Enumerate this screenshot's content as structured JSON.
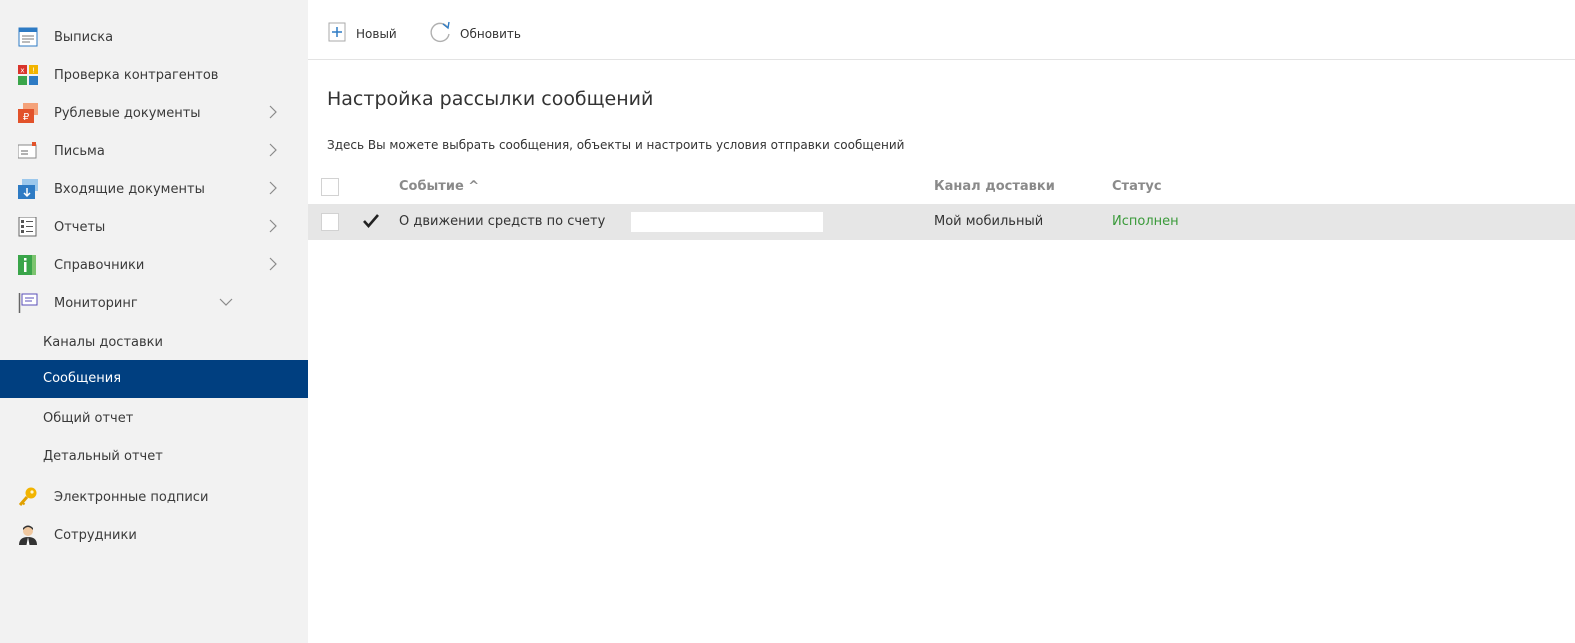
{
  "sidebar": {
    "items": [
      {
        "label": "Выписка",
        "icon": "statement-icon",
        "has_chevron": false
      },
      {
        "label": "Проверка контрагентов",
        "icon": "contractor-check-icon",
        "has_chevron": false
      },
      {
        "label": "Рублевые документы",
        "icon": "ruble-documents-icon",
        "has_chevron": true
      },
      {
        "label": "Письма",
        "icon": "letters-icon",
        "has_chevron": true
      },
      {
        "label": "Входящие документы",
        "icon": "incoming-documents-icon",
        "has_chevron": true
      },
      {
        "label": "Отчеты",
        "icon": "reports-icon",
        "has_chevron": true
      },
      {
        "label": "Справочники",
        "icon": "directories-icon",
        "has_chevron": true
      },
      {
        "label": "Мониторинг",
        "icon": "monitoring-icon",
        "has_chevron": true,
        "expanded": true
      }
    ],
    "subitems": [
      {
        "label": "Каналы доставки",
        "active": false
      },
      {
        "label": "Сообщения",
        "active": true
      },
      {
        "label": "Общий отчет",
        "active": false
      },
      {
        "label": "Детальный отчет",
        "active": false
      }
    ],
    "bottom_items": [
      {
        "label": "Электронные подписи",
        "icon": "key-icon"
      },
      {
        "label": "Сотрудники",
        "icon": "employee-icon"
      }
    ],
    "active_color": "#003f80"
  },
  "toolbar": {
    "new_label": "Новый",
    "refresh_label": "Обновить"
  },
  "main": {
    "title": "Настройка рассылки сообщений",
    "description": "Здесь Вы можете выбрать сообщения, объекты и настроить условия отправки сообщений"
  },
  "table": {
    "columns": {
      "event": "Событие ^",
      "channel": "Канал доставки",
      "status": "Статус"
    },
    "rows": [
      {
        "event": "О движении средств по счету",
        "channel": "Мой мобильный",
        "status": "Исполнен",
        "enabled": true
      }
    ],
    "status_color": "#3a9a3a"
  }
}
